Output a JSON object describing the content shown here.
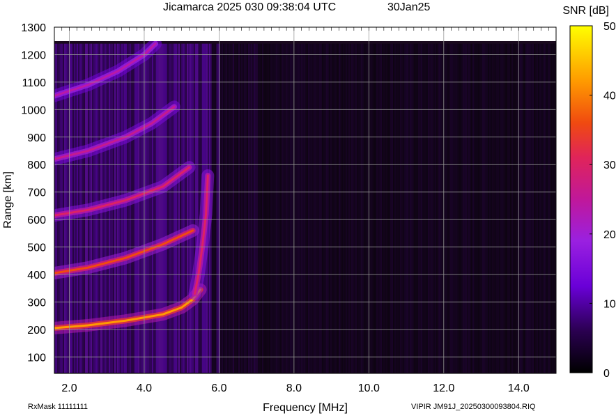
{
  "chart_data": {
    "type": "heatmap",
    "title_left": "Jicamarca 2025 030 09:38:04 UTC",
    "title_right": "30Jan25",
    "xlabel": "Frequency [MHz]",
    "ylabel": "Range [km]",
    "xlim": [
      1.6,
      15.0
    ],
    "ylim": [
      40,
      1300
    ],
    "data_top_range": 1240,
    "x_ticks": [
      {
        "v": 2.0,
        "label": "2.0"
      },
      {
        "v": 4.0,
        "label": "4.0"
      },
      {
        "v": 6.0,
        "label": "6.0"
      },
      {
        "v": 8.0,
        "label": "8.0"
      },
      {
        "v": 10.0,
        "label": "10.0"
      },
      {
        "v": 12.0,
        "label": "12.0"
      },
      {
        "v": 14.0,
        "label": "14.0"
      }
    ],
    "y_ticks": [
      {
        "v": 100,
        "label": "100"
      },
      {
        "v": 200,
        "label": "200"
      },
      {
        "v": 300,
        "label": "300"
      },
      {
        "v": 400,
        "label": "400"
      },
      {
        "v": 500,
        "label": "500"
      },
      {
        "v": 600,
        "label": "600"
      },
      {
        "v": 700,
        "label": "700"
      },
      {
        "v": 800,
        "label": "800"
      },
      {
        "v": 900,
        "label": "900"
      },
      {
        "v": 1000,
        "label": "1000"
      },
      {
        "v": 1100,
        "label": "1100"
      },
      {
        "v": 1200,
        "label": "1200"
      },
      {
        "v": 1300,
        "label": "1300"
      }
    ],
    "colorbar": {
      "label": "SNR [dB]",
      "range": [
        0,
        50
      ],
      "ticks": [
        {
          "v": 0,
          "label": "0"
        },
        {
          "v": 10,
          "label": "10"
        },
        {
          "v": 20,
          "label": "20"
        },
        {
          "v": 30,
          "label": "30"
        },
        {
          "v": 40,
          "label": "40"
        },
        {
          "v": 50,
          "label": "50"
        }
      ]
    },
    "traces": [
      {
        "freq": [
          1.6,
          2.5,
          3.5,
          4.5,
          5.0,
          5.3,
          5.5
        ],
        "range": [
          205,
          215,
          232,
          255,
          280,
          310,
          345
        ],
        "snr": 42
      },
      {
        "freq": [
          5.35,
          5.45,
          5.55,
          5.65,
          5.7
        ],
        "range": [
          330,
          400,
          500,
          620,
          760
        ],
        "snr": 30
      },
      {
        "freq": [
          1.6,
          2.5,
          3.5,
          4.5,
          5.3
        ],
        "range": [
          405,
          425,
          460,
          510,
          560
        ],
        "snr": 36
      },
      {
        "freq": [
          1.6,
          2.5,
          3.5,
          4.5,
          5.2
        ],
        "range": [
          615,
          635,
          670,
          720,
          790
        ],
        "snr": 30
      },
      {
        "freq": [
          1.6,
          2.5,
          3.5,
          4.2,
          4.8
        ],
        "range": [
          820,
          850,
          900,
          950,
          1010
        ],
        "snr": 26
      },
      {
        "freq": [
          1.6,
          2.5,
          3.3,
          4.0,
          4.3
        ],
        "range": [
          1050,
          1090,
          1140,
          1200,
          1240
        ],
        "snr": 24
      }
    ],
    "colors": {
      "background": "#1a0a1e",
      "high": "#ffff00",
      "mid": "#ff6a00",
      "low": "#7a1fff"
    }
  },
  "footer": {
    "left": "RxMask 11111111",
    "right": "VIPIR  JM91J_20250300093804.RIQ"
  }
}
